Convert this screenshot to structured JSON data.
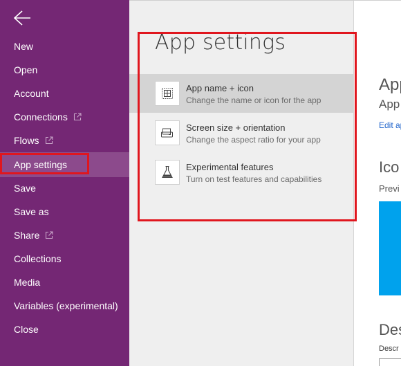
{
  "sidebar": {
    "items": [
      {
        "label": "New",
        "external": false
      },
      {
        "label": "Open",
        "external": false
      },
      {
        "label": "Account",
        "external": false
      },
      {
        "label": "Connections",
        "external": true
      },
      {
        "label": "Flows",
        "external": true
      },
      {
        "label": "App settings",
        "external": false,
        "active": true
      },
      {
        "label": "Save",
        "external": false
      },
      {
        "label": "Save as",
        "external": false
      },
      {
        "label": "Share",
        "external": true
      },
      {
        "label": "Collections",
        "external": false
      },
      {
        "label": "Media",
        "external": false
      },
      {
        "label": "Variables (experimental)",
        "external": false
      },
      {
        "label": "Close",
        "external": false
      }
    ]
  },
  "panel": {
    "title": "App settings",
    "options": [
      {
        "title": "App name + icon",
        "desc": "Change the name or icon for the app",
        "icon": "app-tile-icon",
        "selected": true
      },
      {
        "title": "Screen size + orientation",
        "desc": "Change the aspect ratio for your app",
        "icon": "screen-orientation-icon",
        "selected": false
      },
      {
        "title": "Experimental features",
        "desc": "Turn on test features and capabilities",
        "icon": "flask-icon",
        "selected": false
      }
    ]
  },
  "right": {
    "heading": "App",
    "subheading": "App",
    "link": "Edit ap",
    "icon_heading": "Ico",
    "preview_label": "Previ",
    "desc_heading": "Des",
    "desc_label": "Descr"
  },
  "colors": {
    "sidebar": "#742774",
    "sidebar_active": "#8c4a8c",
    "highlight": "#e0161e",
    "preview_blue": "#00a2ed",
    "link": "#2266cc"
  }
}
